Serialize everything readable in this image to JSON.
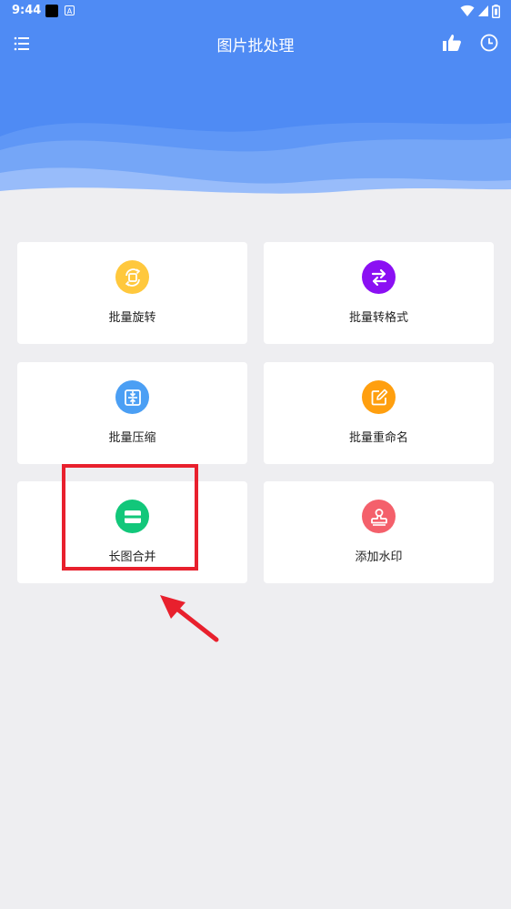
{
  "status_bar": {
    "time": "9:44"
  },
  "app": {
    "title": "图片批处理"
  },
  "colors": {
    "header_bg": "#4f8bf4",
    "rotate": "#ffc83d",
    "convert": "#8b10f3",
    "compress": "#4b9ff4",
    "rename": "#ff9f0f",
    "merge": "#12c77a",
    "watermark": "#f4606b",
    "highlight": "#e8202d"
  },
  "tools": [
    {
      "label": "批量旋转",
      "icon": "rotate-icon"
    },
    {
      "label": "批量转格式",
      "icon": "swap-arrows-icon"
    },
    {
      "label": "批量压缩",
      "icon": "compress-icon"
    },
    {
      "label": "批量重命名",
      "icon": "edit-icon"
    },
    {
      "label": "长图合并",
      "icon": "merge-icon"
    },
    {
      "label": "添加水印",
      "icon": "stamp-icon"
    }
  ]
}
